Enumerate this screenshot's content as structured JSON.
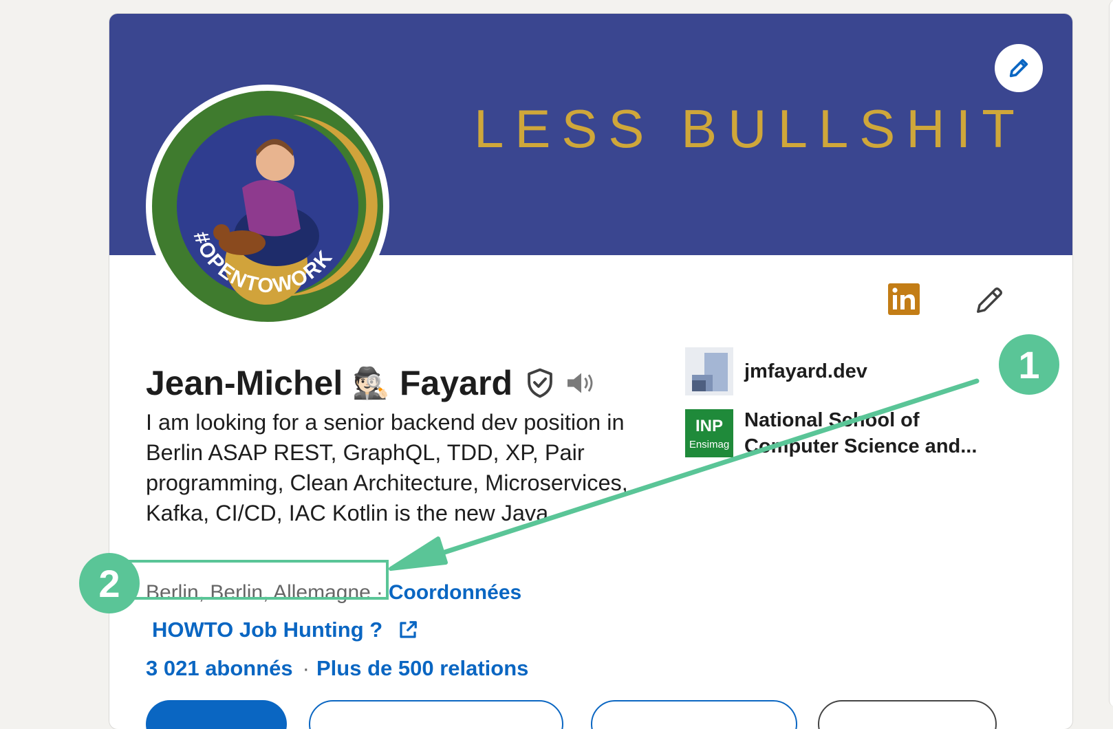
{
  "banner": {
    "text": "LESS BULLSHIT",
    "color": "#3a4690",
    "text_color": "#cfa73a",
    "edit_icon": "pencil-icon"
  },
  "avatar": {
    "badge_text": "#OPENTOWORK",
    "badge_color": "#3f7b2e"
  },
  "profile": {
    "first_name": "Jean-Michel",
    "emoji": "🕵🏻",
    "last_name": "Fayard",
    "verified_icon": "verified-shield-icon",
    "pronunciation_icon": "speaker-icon",
    "headline": "I am looking for a senior backend dev position in Berlin ASAP REST, GraphQL, TDD, XP, Pair programming, Clean Architecture, Microservices, Kafka, CI/CD, IAC Kotlin is the new Java",
    "location": "Berlin, Berlin, Allemagne",
    "separator": "·",
    "contact_link": "Coordonnées",
    "website_link": "HOWTO Job Hunting ?",
    "followers": "3 021 abonnés",
    "connections": "Plus de 500 relations"
  },
  "side": {
    "website": "jmfayard.dev",
    "school_logo_top": "INP",
    "school_logo_bottom": "Ensimag",
    "school": "National School of Computer Science and..."
  },
  "icons": {
    "linkedin": "linkedin-icon",
    "edit": "pencil-icon",
    "external_link": "external-link-icon"
  },
  "buttons": {
    "primary": "",
    "second": "",
    "third": "",
    "fourth": ""
  },
  "annotations": {
    "badge_1": "1",
    "badge_2": "2",
    "color": "#5ac597"
  },
  "colors": {
    "link_blue": "#0a66c2",
    "linkedin_brand": "#c37d16"
  }
}
